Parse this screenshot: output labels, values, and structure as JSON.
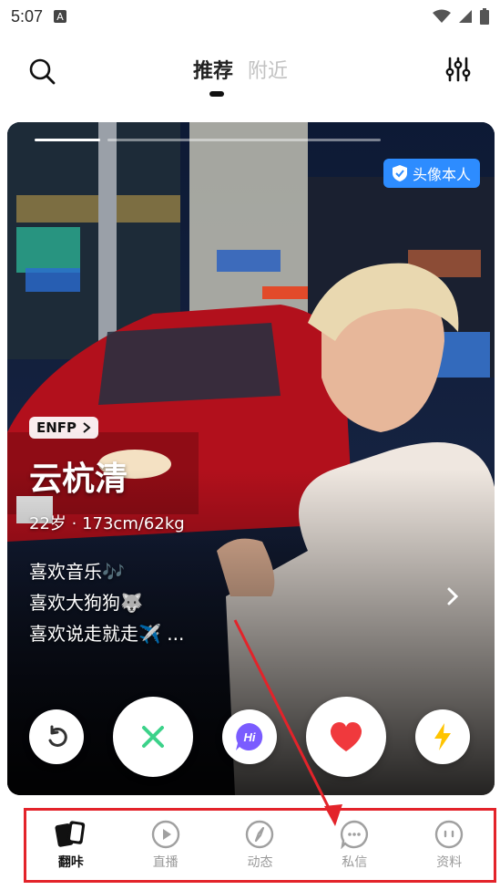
{
  "status_bar": {
    "time": "5:07",
    "ime_glyph": "A"
  },
  "top_nav": {
    "tabs": [
      {
        "label": "推荐",
        "active": true
      },
      {
        "label": "附近",
        "active": false
      }
    ]
  },
  "card": {
    "verified_label": "头像本人",
    "mbti_tag": "ENFP",
    "name": "云杭清",
    "meta": "22岁 · 173cm/62kg",
    "likes": [
      "喜欢音乐🎶",
      "喜欢大狗狗🐺",
      "喜欢说走就走✈️ ..."
    ],
    "photo_progress": {
      "total": 3,
      "current": 1
    }
  },
  "actions": {
    "hi_label": "Hi"
  },
  "tabbar": {
    "items": [
      {
        "label": "翻咔",
        "icon": "cards-icon",
        "active": true
      },
      {
        "label": "直播",
        "icon": "play-circle-icon",
        "active": false
      },
      {
        "label": "动态",
        "icon": "compass-icon",
        "active": false
      },
      {
        "label": "私信",
        "icon": "chat-bubble-icon",
        "active": false
      },
      {
        "label": "资料",
        "icon": "profile-face-icon",
        "active": false
      }
    ]
  },
  "colors": {
    "accent_red": "#e3232a",
    "verify_blue": "#2d8cff",
    "like_red": "#f0393d",
    "pass_green": "#3cd28a",
    "hi_purple": "#7a5cff",
    "boost_yellow": "#ffc400"
  }
}
